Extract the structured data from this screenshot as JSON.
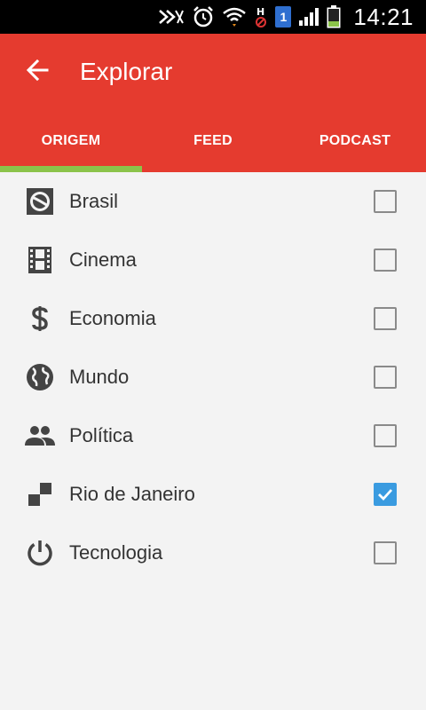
{
  "status_bar": {
    "time": "14:21",
    "sim_slot": "1",
    "icons": [
      "nfc-off-icon",
      "alarm-icon",
      "wifi-icon",
      "h-no-data-icon",
      "sim-icon",
      "signal-icon",
      "battery-icon"
    ]
  },
  "app_bar": {
    "title": "Explorar",
    "back_icon": "arrow-back-icon",
    "color": "#e53b2f"
  },
  "tabs": [
    {
      "label": "ORIGEM",
      "active": true
    },
    {
      "label": "FEED",
      "active": false
    },
    {
      "label": "PODCAST",
      "active": false
    }
  ],
  "accent_indicator": "#8bc34a",
  "checkbox_color": "#3a9be0",
  "items": [
    {
      "label": "Brasil",
      "icon": "brasil-logo-icon",
      "checked": false
    },
    {
      "label": "Cinema",
      "icon": "film-strip-icon",
      "checked": false
    },
    {
      "label": "Economia",
      "icon": "dollar-icon",
      "checked": false
    },
    {
      "label": "Mundo",
      "icon": "globe-icon",
      "checked": false
    },
    {
      "label": "Política",
      "icon": "people-icon",
      "checked": false
    },
    {
      "label": "Rio de Janeiro",
      "icon": "checker-blocks-icon",
      "checked": true
    },
    {
      "label": "Tecnologia",
      "icon": "power-icon",
      "checked": false
    }
  ]
}
